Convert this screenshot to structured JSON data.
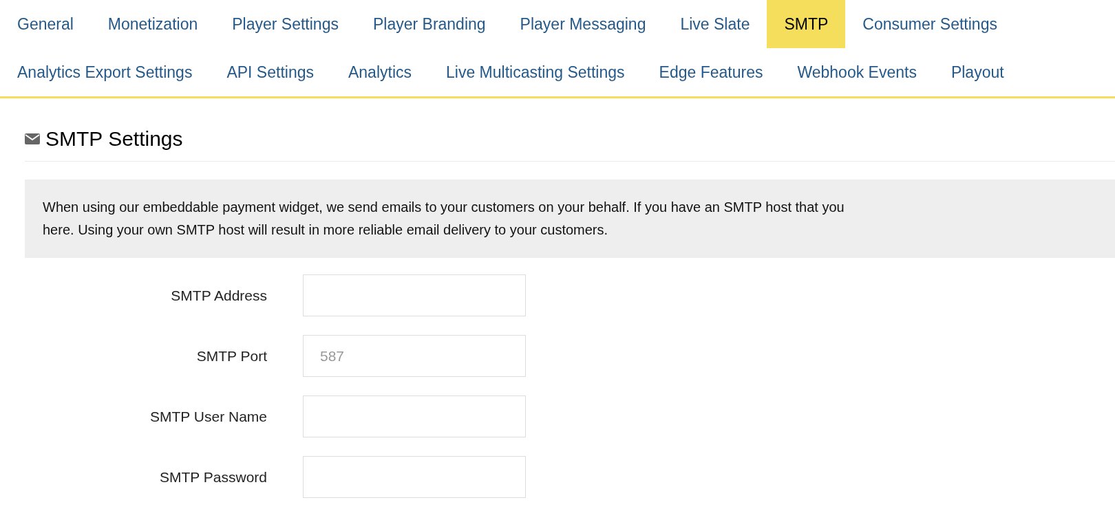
{
  "tab_rows": [
    [
      {
        "label": "General",
        "selected": false
      },
      {
        "label": "Monetization",
        "selected": false
      },
      {
        "label": "Player Settings",
        "selected": false
      },
      {
        "label": "Player Branding",
        "selected": false
      },
      {
        "label": "Player Messaging",
        "selected": false
      },
      {
        "label": "Live Slate",
        "selected": false
      },
      {
        "label": "SMTP",
        "selected": true
      },
      {
        "label": "Consumer Settings",
        "selected": false
      }
    ],
    [
      {
        "label": "Analytics Export Settings",
        "selected": false
      },
      {
        "label": "API Settings",
        "selected": false
      },
      {
        "label": "Analytics",
        "selected": false
      },
      {
        "label": "Live Multicasting Settings",
        "selected": false
      },
      {
        "label": "Edge Features",
        "selected": false
      },
      {
        "label": "Webhook Events",
        "selected": false
      },
      {
        "label": "Playout",
        "selected": false
      }
    ]
  ],
  "section": {
    "title": "SMTP Settings",
    "notice_lines": [
      "When using our embeddable payment widget, we send emails to your customers on your behalf. If you have an SMTP host that you",
      "here. Using your own SMTP host will result in more reliable email delivery to your customers."
    ],
    "fields": [
      {
        "label": "SMTP Address"
      },
      {
        "label": "SMTP Port",
        "placeholder": "587"
      },
      {
        "label": "SMTP User Name"
      },
      {
        "label": "SMTP Password"
      }
    ]
  }
}
